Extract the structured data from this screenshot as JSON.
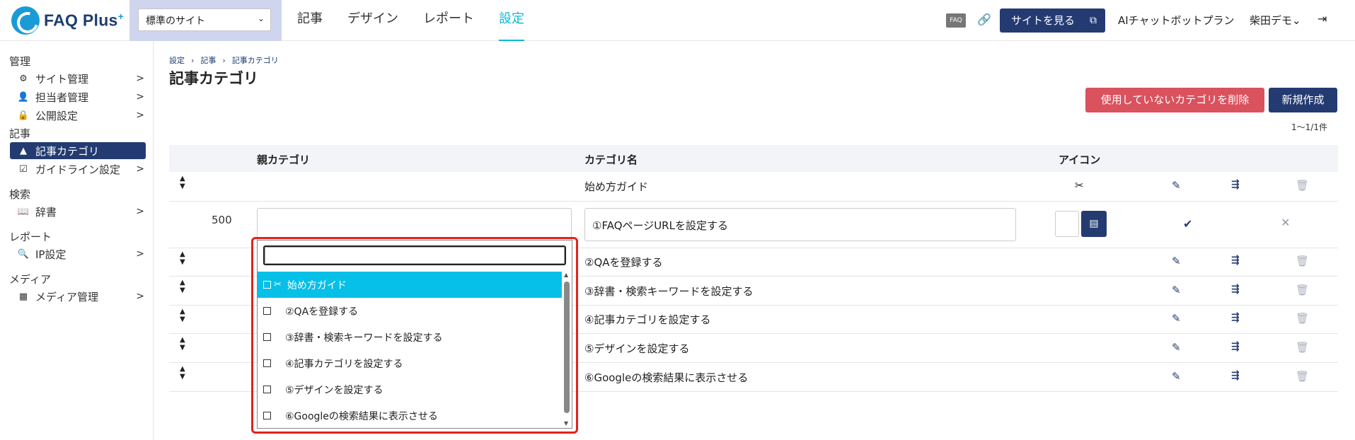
{
  "header": {
    "logo_text": "FAQ Plus",
    "logo_sup": "+",
    "site_select": "標準のサイト",
    "nav": [
      {
        "label": "記事",
        "active": false
      },
      {
        "label": "デザイン",
        "active": false
      },
      {
        "label": "レポート",
        "active": false
      },
      {
        "label": "設定",
        "active": true
      }
    ],
    "faq_badge": "FAQ",
    "view_site_label": "サイトを見る",
    "plan": "AIチャットボットプラン",
    "user": "柴田デモ",
    "user_caret": "⌄"
  },
  "sidebar": {
    "sections": [
      {
        "title": "管理",
        "items": [
          {
            "label": "サイト管理",
            "icon": "gear-icon",
            "glyph": "✿"
          },
          {
            "label": "担当者管理",
            "icon": "users-icon",
            "glyph": "👥"
          },
          {
            "label": "公開設定",
            "icon": "lock-icon",
            "glyph": "🔒"
          }
        ]
      },
      {
        "title": "記事",
        "items": [
          {
            "label": "記事カテゴリ",
            "icon": "shapes-icon",
            "glyph": "▲",
            "active": true
          },
          {
            "label": "ガイドライン設定",
            "icon": "checklist-icon",
            "glyph": "☑"
          }
        ]
      },
      {
        "title": "検索",
        "items": [
          {
            "label": "辞書",
            "icon": "book-icon",
            "glyph": "📖"
          }
        ]
      },
      {
        "title": "レポート",
        "items": [
          {
            "label": "IP設定",
            "icon": "search-location-icon",
            "glyph": "🔍"
          }
        ]
      },
      {
        "title": "メディア",
        "items": [
          {
            "label": "メディア管理",
            "icon": "images-icon",
            "glyph": "▦"
          }
        ]
      }
    ],
    "arrow": ">"
  },
  "breadcrumb": [
    "設定",
    "記事",
    "記事カテゴリ"
  ],
  "breadcrumb_sep": "›",
  "page_title": "記事カテゴリ",
  "buttons": {
    "delete_unused": "使用していないカテゴリを削除",
    "new": "新規作成"
  },
  "count": "1〜1/1件",
  "table": {
    "headers": {
      "parent": "親カテゴリ",
      "name": "カテゴリ名",
      "icon": "アイコン"
    },
    "first_row": {
      "name": "始め方ガイド",
      "icon": "tools-icon"
    },
    "edit_row": {
      "sort": "500",
      "name": "①FAQページURLを設定する"
    },
    "rows": [
      {
        "name": "②QAを登録する"
      },
      {
        "name": "③辞書・検索キーワードを設定する"
      },
      {
        "name": "④記事カテゴリを設定する"
      },
      {
        "name": "⑤デザインを設定する"
      },
      {
        "name": "⑥Googleの検索結果に表示させる"
      }
    ]
  },
  "dropdown": {
    "search_value": "",
    "options": [
      {
        "label": "始め方ガイド",
        "selected": true
      },
      {
        "label": "②QAを登録する",
        "selected": false
      },
      {
        "label": "③辞書・検索キーワードを設定する",
        "selected": false
      },
      {
        "label": "④記事カテゴリを設定する",
        "selected": false
      },
      {
        "label": "⑤デザインを設定する",
        "selected": false
      },
      {
        "label": "⑥Googleの検索結果に表示させる",
        "selected": false
      }
    ]
  },
  "colors": {
    "brand_navy": "#243b72",
    "accent_cyan": "#11b5d8",
    "danger": "#d9525e",
    "highlight_red": "#e5211c"
  }
}
